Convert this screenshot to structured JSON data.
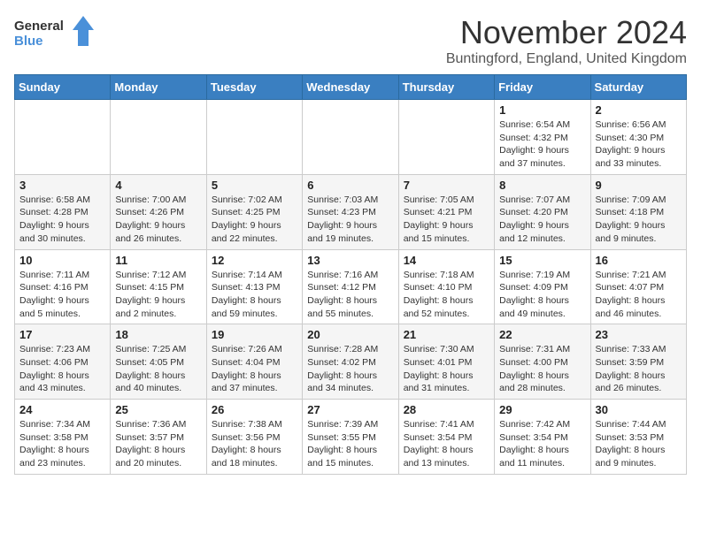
{
  "logo": {
    "line1": "General",
    "line2": "Blue"
  },
  "title": "November 2024",
  "location": "Buntingford, England, United Kingdom",
  "days_of_week": [
    "Sunday",
    "Monday",
    "Tuesday",
    "Wednesday",
    "Thursday",
    "Friday",
    "Saturday"
  ],
  "weeks": [
    [
      {
        "day": "",
        "info": ""
      },
      {
        "day": "",
        "info": ""
      },
      {
        "day": "",
        "info": ""
      },
      {
        "day": "",
        "info": ""
      },
      {
        "day": "",
        "info": ""
      },
      {
        "day": "1",
        "info": "Sunrise: 6:54 AM\nSunset: 4:32 PM\nDaylight: 9 hours\nand 37 minutes."
      },
      {
        "day": "2",
        "info": "Sunrise: 6:56 AM\nSunset: 4:30 PM\nDaylight: 9 hours\nand 33 minutes."
      }
    ],
    [
      {
        "day": "3",
        "info": "Sunrise: 6:58 AM\nSunset: 4:28 PM\nDaylight: 9 hours\nand 30 minutes."
      },
      {
        "day": "4",
        "info": "Sunrise: 7:00 AM\nSunset: 4:26 PM\nDaylight: 9 hours\nand 26 minutes."
      },
      {
        "day": "5",
        "info": "Sunrise: 7:02 AM\nSunset: 4:25 PM\nDaylight: 9 hours\nand 22 minutes."
      },
      {
        "day": "6",
        "info": "Sunrise: 7:03 AM\nSunset: 4:23 PM\nDaylight: 9 hours\nand 19 minutes."
      },
      {
        "day": "7",
        "info": "Sunrise: 7:05 AM\nSunset: 4:21 PM\nDaylight: 9 hours\nand 15 minutes."
      },
      {
        "day": "8",
        "info": "Sunrise: 7:07 AM\nSunset: 4:20 PM\nDaylight: 9 hours\nand 12 minutes."
      },
      {
        "day": "9",
        "info": "Sunrise: 7:09 AM\nSunset: 4:18 PM\nDaylight: 9 hours\nand 9 minutes."
      }
    ],
    [
      {
        "day": "10",
        "info": "Sunrise: 7:11 AM\nSunset: 4:16 PM\nDaylight: 9 hours\nand 5 minutes."
      },
      {
        "day": "11",
        "info": "Sunrise: 7:12 AM\nSunset: 4:15 PM\nDaylight: 9 hours\nand 2 minutes."
      },
      {
        "day": "12",
        "info": "Sunrise: 7:14 AM\nSunset: 4:13 PM\nDaylight: 8 hours\nand 59 minutes."
      },
      {
        "day": "13",
        "info": "Sunrise: 7:16 AM\nSunset: 4:12 PM\nDaylight: 8 hours\nand 55 minutes."
      },
      {
        "day": "14",
        "info": "Sunrise: 7:18 AM\nSunset: 4:10 PM\nDaylight: 8 hours\nand 52 minutes."
      },
      {
        "day": "15",
        "info": "Sunrise: 7:19 AM\nSunset: 4:09 PM\nDaylight: 8 hours\nand 49 minutes."
      },
      {
        "day": "16",
        "info": "Sunrise: 7:21 AM\nSunset: 4:07 PM\nDaylight: 8 hours\nand 46 minutes."
      }
    ],
    [
      {
        "day": "17",
        "info": "Sunrise: 7:23 AM\nSunset: 4:06 PM\nDaylight: 8 hours\nand 43 minutes."
      },
      {
        "day": "18",
        "info": "Sunrise: 7:25 AM\nSunset: 4:05 PM\nDaylight: 8 hours\nand 40 minutes."
      },
      {
        "day": "19",
        "info": "Sunrise: 7:26 AM\nSunset: 4:04 PM\nDaylight: 8 hours\nand 37 minutes."
      },
      {
        "day": "20",
        "info": "Sunrise: 7:28 AM\nSunset: 4:02 PM\nDaylight: 8 hours\nand 34 minutes."
      },
      {
        "day": "21",
        "info": "Sunrise: 7:30 AM\nSunset: 4:01 PM\nDaylight: 8 hours\nand 31 minutes."
      },
      {
        "day": "22",
        "info": "Sunrise: 7:31 AM\nSunset: 4:00 PM\nDaylight: 8 hours\nand 28 minutes."
      },
      {
        "day": "23",
        "info": "Sunrise: 7:33 AM\nSunset: 3:59 PM\nDaylight: 8 hours\nand 26 minutes."
      }
    ],
    [
      {
        "day": "24",
        "info": "Sunrise: 7:34 AM\nSunset: 3:58 PM\nDaylight: 8 hours\nand 23 minutes."
      },
      {
        "day": "25",
        "info": "Sunrise: 7:36 AM\nSunset: 3:57 PM\nDaylight: 8 hours\nand 20 minutes."
      },
      {
        "day": "26",
        "info": "Sunrise: 7:38 AM\nSunset: 3:56 PM\nDaylight: 8 hours\nand 18 minutes."
      },
      {
        "day": "27",
        "info": "Sunrise: 7:39 AM\nSunset: 3:55 PM\nDaylight: 8 hours\nand 15 minutes."
      },
      {
        "day": "28",
        "info": "Sunrise: 7:41 AM\nSunset: 3:54 PM\nDaylight: 8 hours\nand 13 minutes."
      },
      {
        "day": "29",
        "info": "Sunrise: 7:42 AM\nSunset: 3:54 PM\nDaylight: 8 hours\nand 11 minutes."
      },
      {
        "day": "30",
        "info": "Sunrise: 7:44 AM\nSunset: 3:53 PM\nDaylight: 8 hours\nand 9 minutes."
      }
    ]
  ]
}
